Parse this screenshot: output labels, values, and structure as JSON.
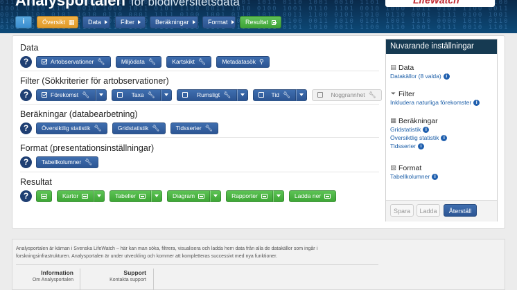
{
  "header": {
    "title": "Analysportalen",
    "subtitle": "för biodiversitetsdata",
    "logo_text": "LifeWatch"
  },
  "nav": {
    "info_label": "i",
    "items": [
      {
        "label": "Översikt"
      },
      {
        "label": "Data"
      },
      {
        "label": "Filter"
      },
      {
        "label": "Beräkningar"
      },
      {
        "label": "Format"
      },
      {
        "label": "Resultat"
      }
    ]
  },
  "sections": {
    "data": {
      "title": "Data",
      "buttons": [
        "Artobservationer",
        "Miljödata",
        "Kartskikt",
        "Metadatasök"
      ]
    },
    "filter": {
      "title": "Filter (Sökkriterier för artobservationer)",
      "buttons": [
        "Förekomst",
        "Taxa",
        "Rumsligt",
        "Tid",
        "Noggrannhet"
      ]
    },
    "calc": {
      "title": "Beräkningar (databearbetning)",
      "buttons": [
        "Översiktlig statistik",
        "Gridstatistik",
        "Tidsserier"
      ]
    },
    "format": {
      "title": "Format (presentationsinställningar)",
      "buttons": [
        "Tabellkolumner"
      ]
    },
    "result": {
      "title": "Resultat",
      "buttons": [
        "Kartor",
        "Tabeller",
        "Diagram",
        "Rapporter",
        "Ladda ner"
      ]
    }
  },
  "side": {
    "title": "Nuvarande inställningar",
    "data": {
      "title": "Data",
      "links": [
        "Datakällor (8 valda)"
      ]
    },
    "filter": {
      "title": "Filter",
      "links": [
        "Inkludera naturliga förekomster"
      ]
    },
    "calc": {
      "title": "Beräkningar",
      "links": [
        "Gridstatistik",
        "Översiktlig statistik",
        "Tidsserier"
      ]
    },
    "format": {
      "title": "Format",
      "links": [
        "Tabellkolumner"
      ]
    },
    "buttons": {
      "save": "Spara",
      "load": "Ladda",
      "reset": "Återställ"
    }
  },
  "footer": {
    "text": "Analysportalen är kärnan i Svenska LifeWatch – här kan man söka, filtrera, visualisera och ladda hem data från alla de datakällor som ingår i forskningsinfrastrukturen. Analysportalen är under utveckling och kommer att kompletteras successivt med nya funktioner.",
    "info": {
      "title": "Information",
      "links": [
        "Om Analysportalen"
      ]
    },
    "support": {
      "title": "Support",
      "links": [
        "Kontakta support"
      ]
    }
  },
  "colors": {
    "primary": "#2c5593",
    "success": "#3ea636",
    "warning": "#e09a2a",
    "sidebar_header": "#163a52"
  }
}
